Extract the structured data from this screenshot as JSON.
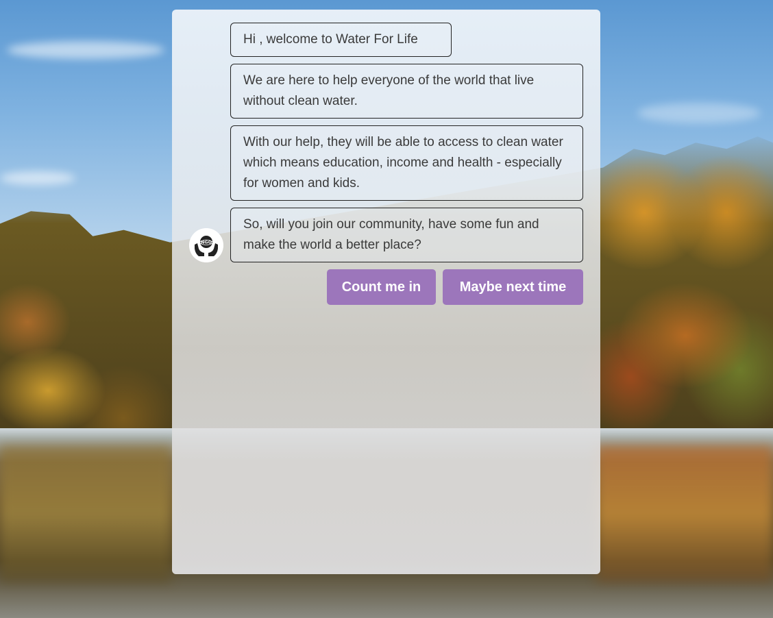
{
  "chat": {
    "messages": [
      "Hi , welcome to Water For Life",
      "We are here to help everyone of the world that live without clean water.",
      "With our help, they will be able to access to clean water which means education, income and health - especially for women and kids.",
      "So, will you join our community, have some fun and make the world a better place?"
    ],
    "avatar": {
      "icon": "ngo-hands-globe-icon",
      "logo_text": "NGO"
    },
    "replies": [
      {
        "label": "Count me in"
      },
      {
        "label": "Maybe next time"
      }
    ]
  },
  "colors": {
    "button": "#9c76bb",
    "button_text": "#ffffff",
    "bubble_border": "#222222",
    "message_text": "#3a3a3a"
  }
}
